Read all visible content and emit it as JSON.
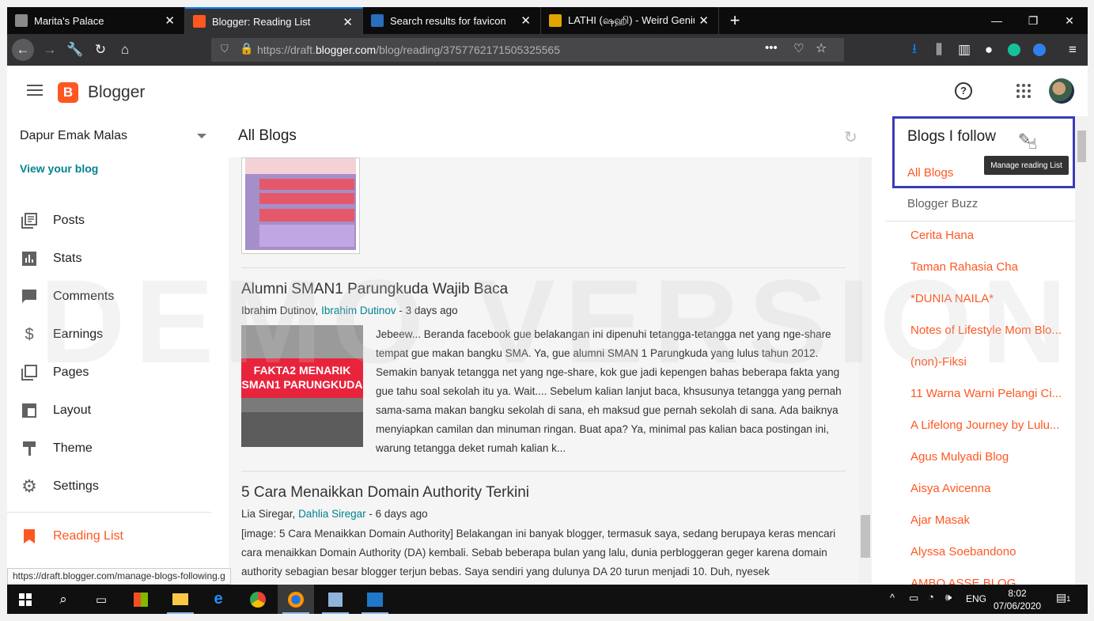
{
  "browser": {
    "tabs": [
      {
        "title": "Marita's Palace",
        "active": false,
        "favicon_color": "#8a8a8a"
      },
      {
        "title": "Blogger: Reading List",
        "active": true,
        "favicon_color": "#ff5722"
      },
      {
        "title": "Search results for favicon",
        "active": false,
        "favicon_color": "#2a6ebb"
      },
      {
        "title": "LATHI (ஷஹி) - Weird Genius - [",
        "active": false,
        "favicon_color": "#e2a400"
      }
    ],
    "url_dim_prefix": "https://draft.",
    "url_host": "blogger.com",
    "url_rest": "/blog/reading/3757762171505325565",
    "status_url": "https://draft.blogger.com/manage-blogs-following.g"
  },
  "header": {
    "app_name": "Blogger",
    "logo_letter": "B",
    "help_glyph": "?"
  },
  "sidebar": {
    "blog_name": "Dapur Emak Malas",
    "view_blog": "View your blog",
    "items": [
      {
        "label": "Posts",
        "icon": "posts-icon"
      },
      {
        "label": "Stats",
        "icon": "stats-icon"
      },
      {
        "label": "Comments",
        "icon": "comments-icon"
      },
      {
        "label": "Earnings",
        "icon": "earnings-icon"
      },
      {
        "label": "Pages",
        "icon": "pages-icon"
      },
      {
        "label": "Layout",
        "icon": "layout-icon"
      },
      {
        "label": "Theme",
        "icon": "theme-icon"
      },
      {
        "label": "Settings",
        "icon": "settings-icon"
      }
    ],
    "reading_list": "Reading List"
  },
  "main": {
    "title": "All Blogs",
    "posts": [
      {
        "title": "Alumni SMAN1 Parungkuda Wajib Baca",
        "author": "Ibrahim Dutinov",
        "author_link": "Ibrahim Dutinov",
        "age": " - 3 days ago",
        "thumb_text": "FAKTA2 MENARIK SMAN1 PARUNGKUDA",
        "body": "Jebeew... Beranda facebook gue belakangan ini dipenuhi tetangga-tetangga net yang nge-share tempat gue makan bangku SMA. Ya, gue alumni SMAN 1 Parungkuda yang lulus tahun 2012. Semakin banyak tetangga net yang nge-share, kok gue jadi kepengen bahas beberapa fakta yang gue tahu soal sekolah itu ya. Wait.... Sebelum kalian lanjut baca, khsusunya tetangga yang pernah sama-sama makan bangku sekolah di sana, eh maksud gue pernah sekolah di sana. Ada baiknya menyiapkan camilan dan minuman ringan. Buat apa? Ya, minimal pas kalian baca postingan ini, warung tetangga deket rumah kalian k..."
      },
      {
        "title": "5 Cara Menaikkan Domain Authority Terkini",
        "author": "Lia Siregar",
        "author_link": "Dahlia Siregar",
        "age": " - 6 days ago",
        "body": "[image: 5 Cara Menaikkan Domain Authority] Belakangan ini banyak blogger, termasuk saya, sedang berupaya keras mencari cara menaikkan Domain Authority (DA) kembali. Sebab beberapa bulan yang lalu, dunia perbloggeran geger karena domain authority sebagian besar blogger terjun bebas. Saya sendiri yang dulunya DA 20 turun menjadi 10. Duh, nyesek"
      }
    ]
  },
  "follow": {
    "title": "Blogs I follow",
    "all_blogs": "All Blogs",
    "tooltip": "Manage reading List",
    "blogger_buzz": "Blogger Buzz",
    "blogs": [
      "Cerita Hana",
      "Taman Rahasia Cha",
      "*DUNIA NAILA*",
      "Notes of Lifestyle Mom Blo...",
      "(non)-Fiksi",
      "11 Warna Warni Pelangi Ci...",
      "A Lifelong Journey by Lulu...",
      "Agus Mulyadi Blog",
      "Aisya Avicenna",
      "Ajar Masak",
      "Alyssa Soebandono",
      "AMBO ASSE BLOG"
    ]
  },
  "watermark": "DEMO VERSION",
  "taskbar": {
    "lang": "ENG",
    "time": "8:02",
    "date": "07/06/2020",
    "notif_count": "1"
  },
  "colors": {
    "accent": "#ff5722",
    "teal_link": "#00838f",
    "highlight_border": "#3b3bb8"
  }
}
